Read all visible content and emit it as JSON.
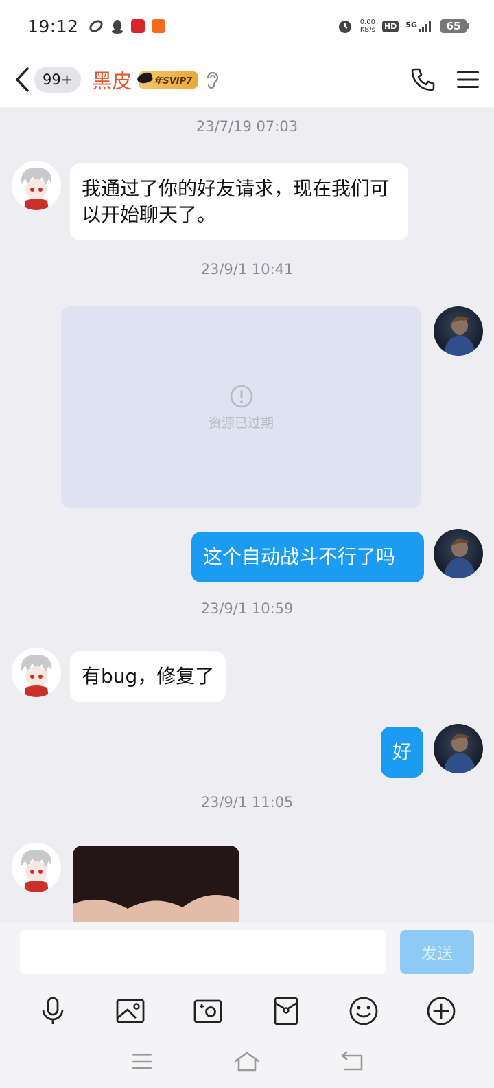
{
  "status_bar": {
    "time": "19:12",
    "net_speed_value": "0.00",
    "net_speed_unit": "KB/s",
    "hd_label": "HD",
    "network_label": "5G",
    "battery": "65"
  },
  "header": {
    "unread_count": "99+",
    "contact_name": "黑皮",
    "vip_label": "年SVIP7",
    "name_color": "#e0542e"
  },
  "messages": [
    {
      "type": "timestamp",
      "text": "23/7/19 07:03"
    },
    {
      "type": "text",
      "direction": "in",
      "text": "我通过了你的好友请求，现在我们可以开始聊天了。"
    },
    {
      "type": "timestamp",
      "text": "23/9/1 10:41"
    },
    {
      "type": "expired_media",
      "direction": "out",
      "text": "资源已过期"
    },
    {
      "type": "text",
      "direction": "out",
      "text": "这个自动战斗不行了吗"
    },
    {
      "type": "timestamp",
      "text": "23/9/1 10:59"
    },
    {
      "type": "text",
      "direction": "in",
      "text": "有bug，修复了"
    },
    {
      "type": "text",
      "direction": "out",
      "text": "好"
    },
    {
      "type": "timestamp",
      "text": "23/9/1 11:05"
    },
    {
      "type": "image",
      "direction": "in"
    }
  ],
  "composer": {
    "input_value": "",
    "send_label": "发送"
  },
  "toolbar_icons": [
    "microphone-icon",
    "image-icon",
    "camera-icon",
    "red-packet-icon",
    "emoji-icon",
    "plus-icon"
  ],
  "system_nav_icons": [
    "menu-icon",
    "home-icon",
    "back-icon"
  ],
  "colors": {
    "accent_blue": "#1b9bf2",
    "send_disabled": "#8ecbf4",
    "chat_background": "#ededf2"
  }
}
